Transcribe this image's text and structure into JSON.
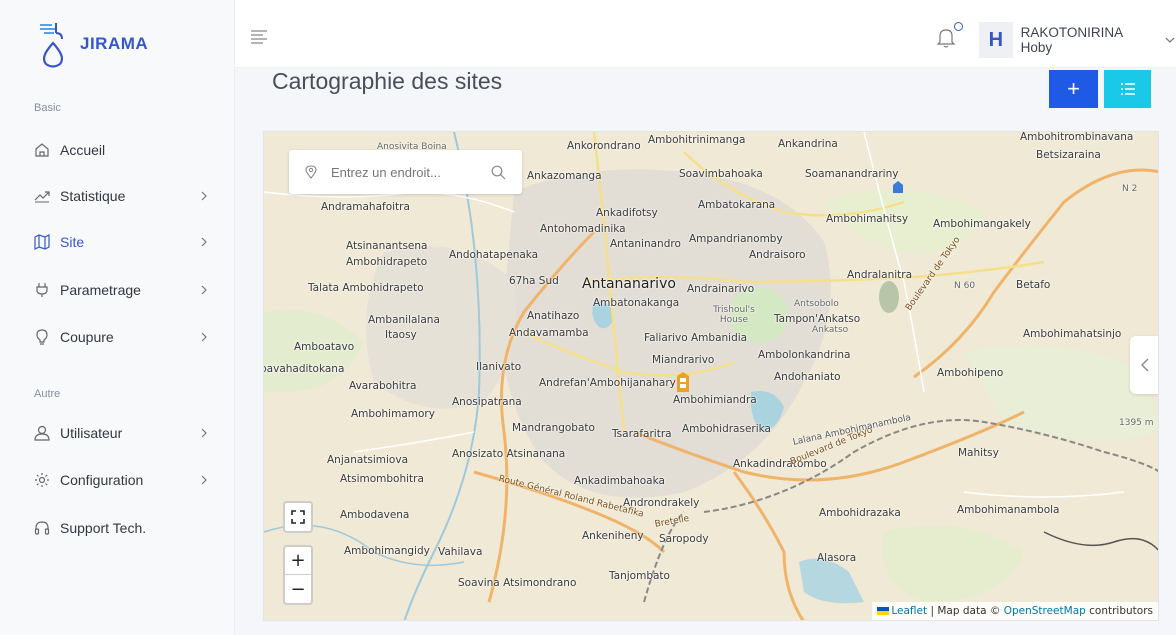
{
  "brand": {
    "name": "JIRAMA"
  },
  "sidebar": {
    "section_basic": "Basic",
    "section_other": "Autre",
    "items": [
      {
        "label": "Accueil"
      },
      {
        "label": "Statistique"
      },
      {
        "label": "Site"
      },
      {
        "label": "Parametrage"
      },
      {
        "label": "Coupure"
      },
      {
        "label": "Utilisateur"
      },
      {
        "label": "Configuration"
      },
      {
        "label": "Support Tech."
      }
    ]
  },
  "header": {
    "user_initial": "H",
    "user_name": "RAKOTONIRINA Hoby"
  },
  "main": {
    "title": "Cartographie des sites",
    "add_label": "+"
  },
  "map": {
    "search_placeholder": "Entrez un endroit...",
    "zoom_in": "+",
    "zoom_out": "−",
    "attribution": {
      "leaflet": "Leaflet",
      "sep": " | Map data © ",
      "osm": "OpenStreetMap",
      "tail": " contributors"
    },
    "places": [
      "Ambohitrinimanga",
      "Ankandrina",
      "Ambohitrombinavana",
      "Ankorondrano",
      "Anosivita Boina",
      "Betsizaraina",
      "Ankazomanga",
      "Soavimbahoaka",
      "Soamanandrariny",
      "N 2",
      "Andramahafoitra",
      "Ankadifotsy",
      "Ambatokarana",
      "Ambohimahitsy",
      "Ambohimangakely",
      "Antohomadinika",
      "Antaninandro",
      "Ampandrianomby",
      "Atsinanantsena",
      "Andohatapenaka",
      "Andraisoro",
      "Ambohidrapeto",
      "Andralanitra",
      "67ha Sud",
      "Antananarivo",
      "Andrainarivo",
      "N 60",
      "Betafo",
      "Talata Ambohidrapeto",
      "Ambatonakanga",
      "Antsobolo",
      "Trishoul's House",
      "Anatihazo",
      "Tampon'Ankatso",
      "Ambanilalana",
      "Ankatso",
      "Itaosy",
      "Andavamamba",
      "Faliarivo Ambanidia",
      "Ambohimahatsinjo",
      "Amboatavo",
      "Ambolonkandrina",
      "Miandrarivo",
      "Ilanivato",
      "Andohaniato",
      "bavahaditokana",
      "Ambohipeno",
      "Andrefan'Ambohijanahary",
      "Avarabohitra",
      "Ambohimiandra",
      "Anosipatrana",
      "Ambohimamory",
      "1395 m",
      "Mandrangobato",
      "Ambohidraserika",
      "Tsarafaritra",
      "Mahitsy",
      "Anjanatsimiova",
      "Anosizato Atsinanana",
      "Ankadindratombo",
      "Atsimombohitra",
      "Ankadimbahoaka",
      "Androndrakely",
      "Ambohidrazaka",
      "Ambohimanambola",
      "Ambodavena",
      "Ankeniheny",
      "Saropody",
      "Ambohimangidy",
      "Vahilava",
      "Alasora",
      "Tanjombato",
      "Soavina Atsimondrano",
      "Boulevard de Tokyo",
      "Route Général Roland Rabetafika",
      "Lalana Ambohimanambola",
      "Bretelle"
    ]
  },
  "colors": {
    "accent": "#3657c9",
    "btn_add": "#1e5ae6",
    "btn_list": "#1ac9e8"
  }
}
